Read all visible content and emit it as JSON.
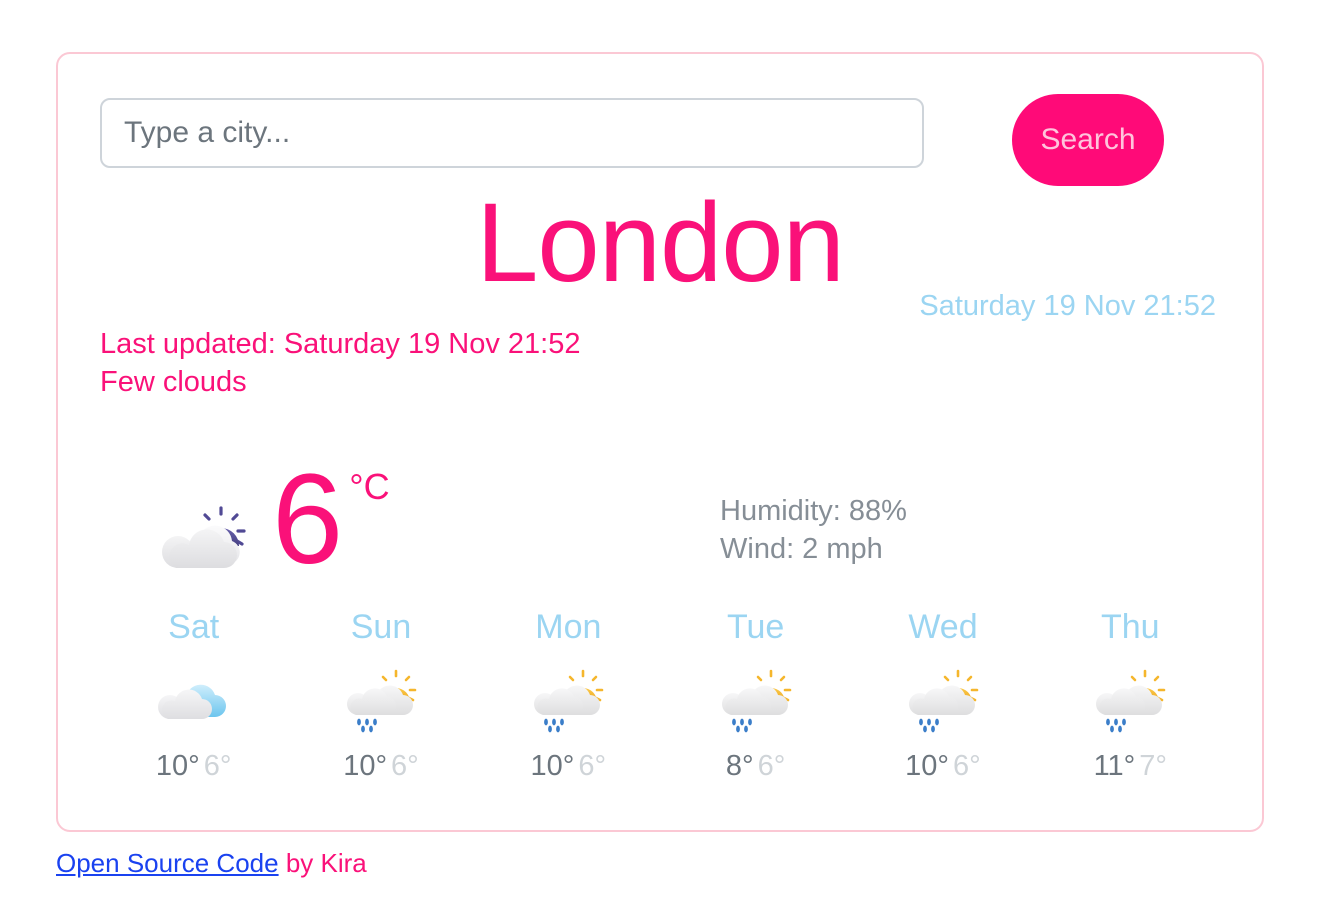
{
  "search": {
    "placeholder": "Type a city...",
    "value": "",
    "button_label": "Search"
  },
  "current": {
    "city": "London",
    "datetime": "Saturday 19 Nov 21:52",
    "last_updated": "Last updated: Saturday 19 Nov 21:52",
    "condition": "Few clouds",
    "temperature": "6",
    "unit": "°C",
    "icon": "few-clouds-night-icon",
    "humidity": "Humidity: 88%",
    "wind": "Wind: 2 mph"
  },
  "forecast": [
    {
      "day": "Sat",
      "icon": "broken-clouds-icon",
      "max": "10°",
      "min": "6°"
    },
    {
      "day": "Sun",
      "icon": "sun-cloud-rain-icon",
      "max": "10°",
      "min": "6°"
    },
    {
      "day": "Mon",
      "icon": "sun-cloud-rain-icon",
      "max": "10°",
      "min": "6°"
    },
    {
      "day": "Tue",
      "icon": "sun-cloud-rain-icon",
      "max": "8°",
      "min": "6°"
    },
    {
      "day": "Wed",
      "icon": "sun-cloud-rain-icon",
      "max": "10°",
      "min": "6°"
    },
    {
      "day": "Thu",
      "icon": "sun-cloud-rain-icon",
      "max": "11°",
      "min": "7°"
    }
  ],
  "footer": {
    "link_text": "Open Source Code",
    "by_text": " by Kira"
  },
  "colors": {
    "pink": "#fa1179",
    "hot_pink": "#ff0a78",
    "light_blue": "#9bd5f2",
    "card_border": "#fbc8d4",
    "link_blue": "#1a42f0",
    "gray_text": "#868e96"
  }
}
